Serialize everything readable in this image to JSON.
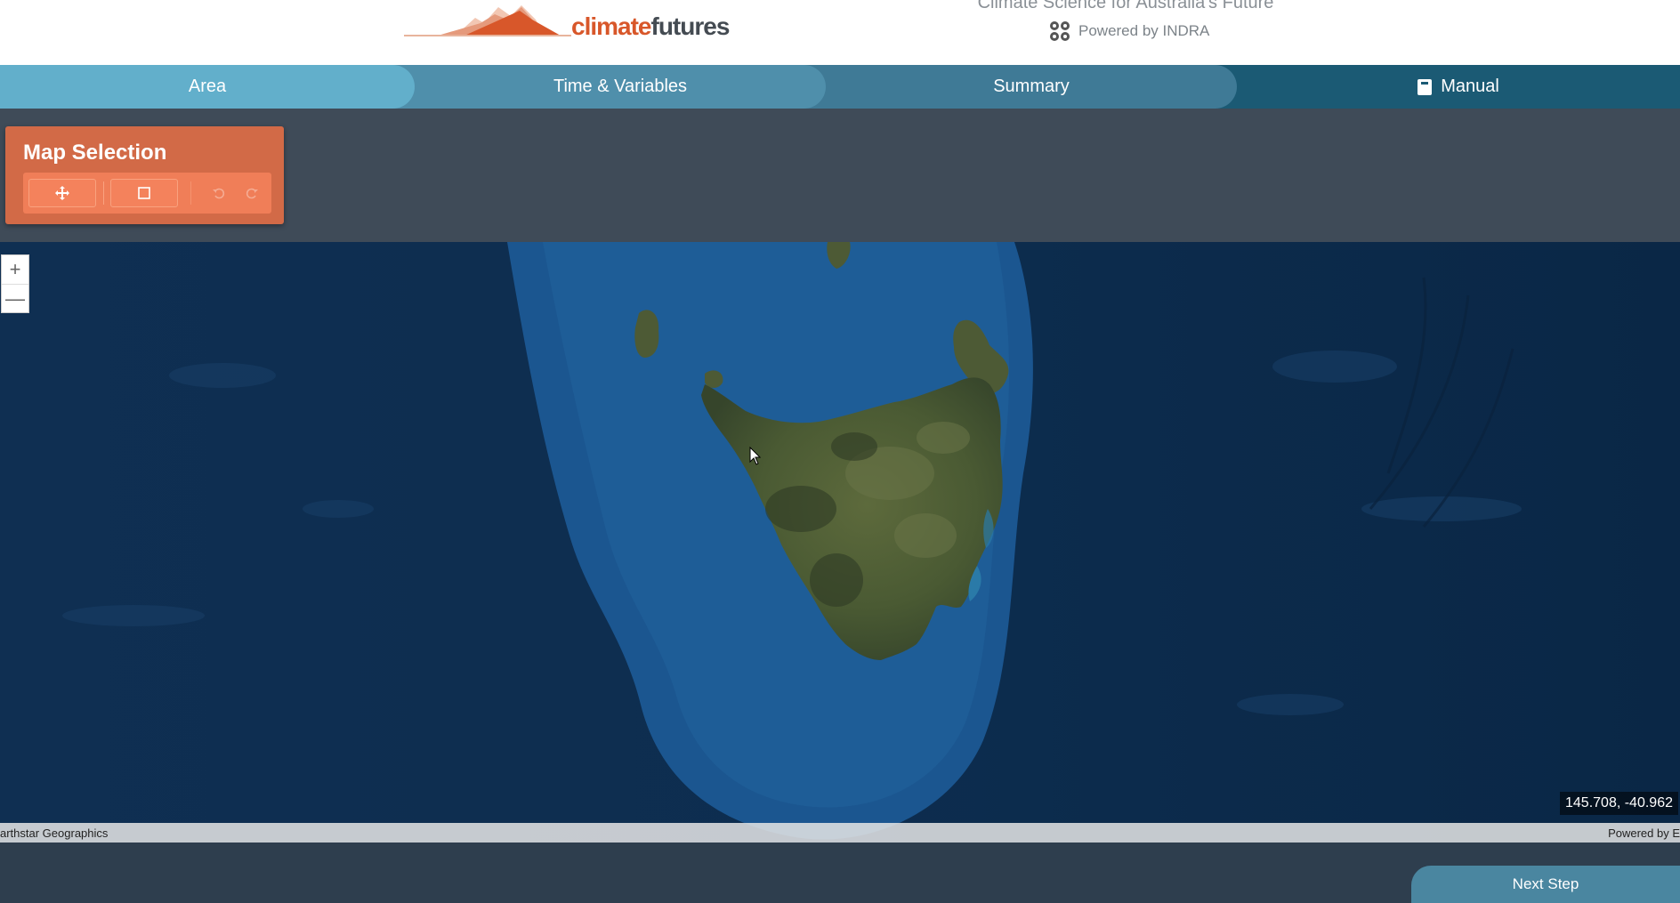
{
  "header": {
    "logo_text_a": "climate",
    "logo_text_b": "futures",
    "tagline": "Climate Science for Australia's Future",
    "powered_by": "Powered by INDRA"
  },
  "steps": [
    {
      "label": "Area",
      "active": true
    },
    {
      "label": "Time & Variables",
      "active": false
    },
    {
      "label": "Summary",
      "active": false
    },
    {
      "label": "Manual",
      "icon": "book-icon"
    }
  ],
  "map_selection": {
    "title": "Map Selection",
    "tools": [
      {
        "name": "pan-tool",
        "icon": "move-icon"
      },
      {
        "name": "rectangle-tool",
        "icon": "square-icon"
      },
      {
        "name": "undo",
        "icon": "undo-icon"
      },
      {
        "name": "redo",
        "icon": "redo-icon"
      }
    ]
  },
  "map": {
    "zoom_in": "+",
    "zoom_out": "—",
    "coordinates": "145.708, -40.962",
    "attribution_left": "arthstar Geographics",
    "attribution_right": "Powered by E"
  },
  "footer": {
    "next_step": "Next Step"
  },
  "colors": {
    "accent_orange": "#d26a47",
    "step_active": "#62afcb",
    "nav_dark": "#1b5a74",
    "ocean": "#0c2b4d"
  }
}
